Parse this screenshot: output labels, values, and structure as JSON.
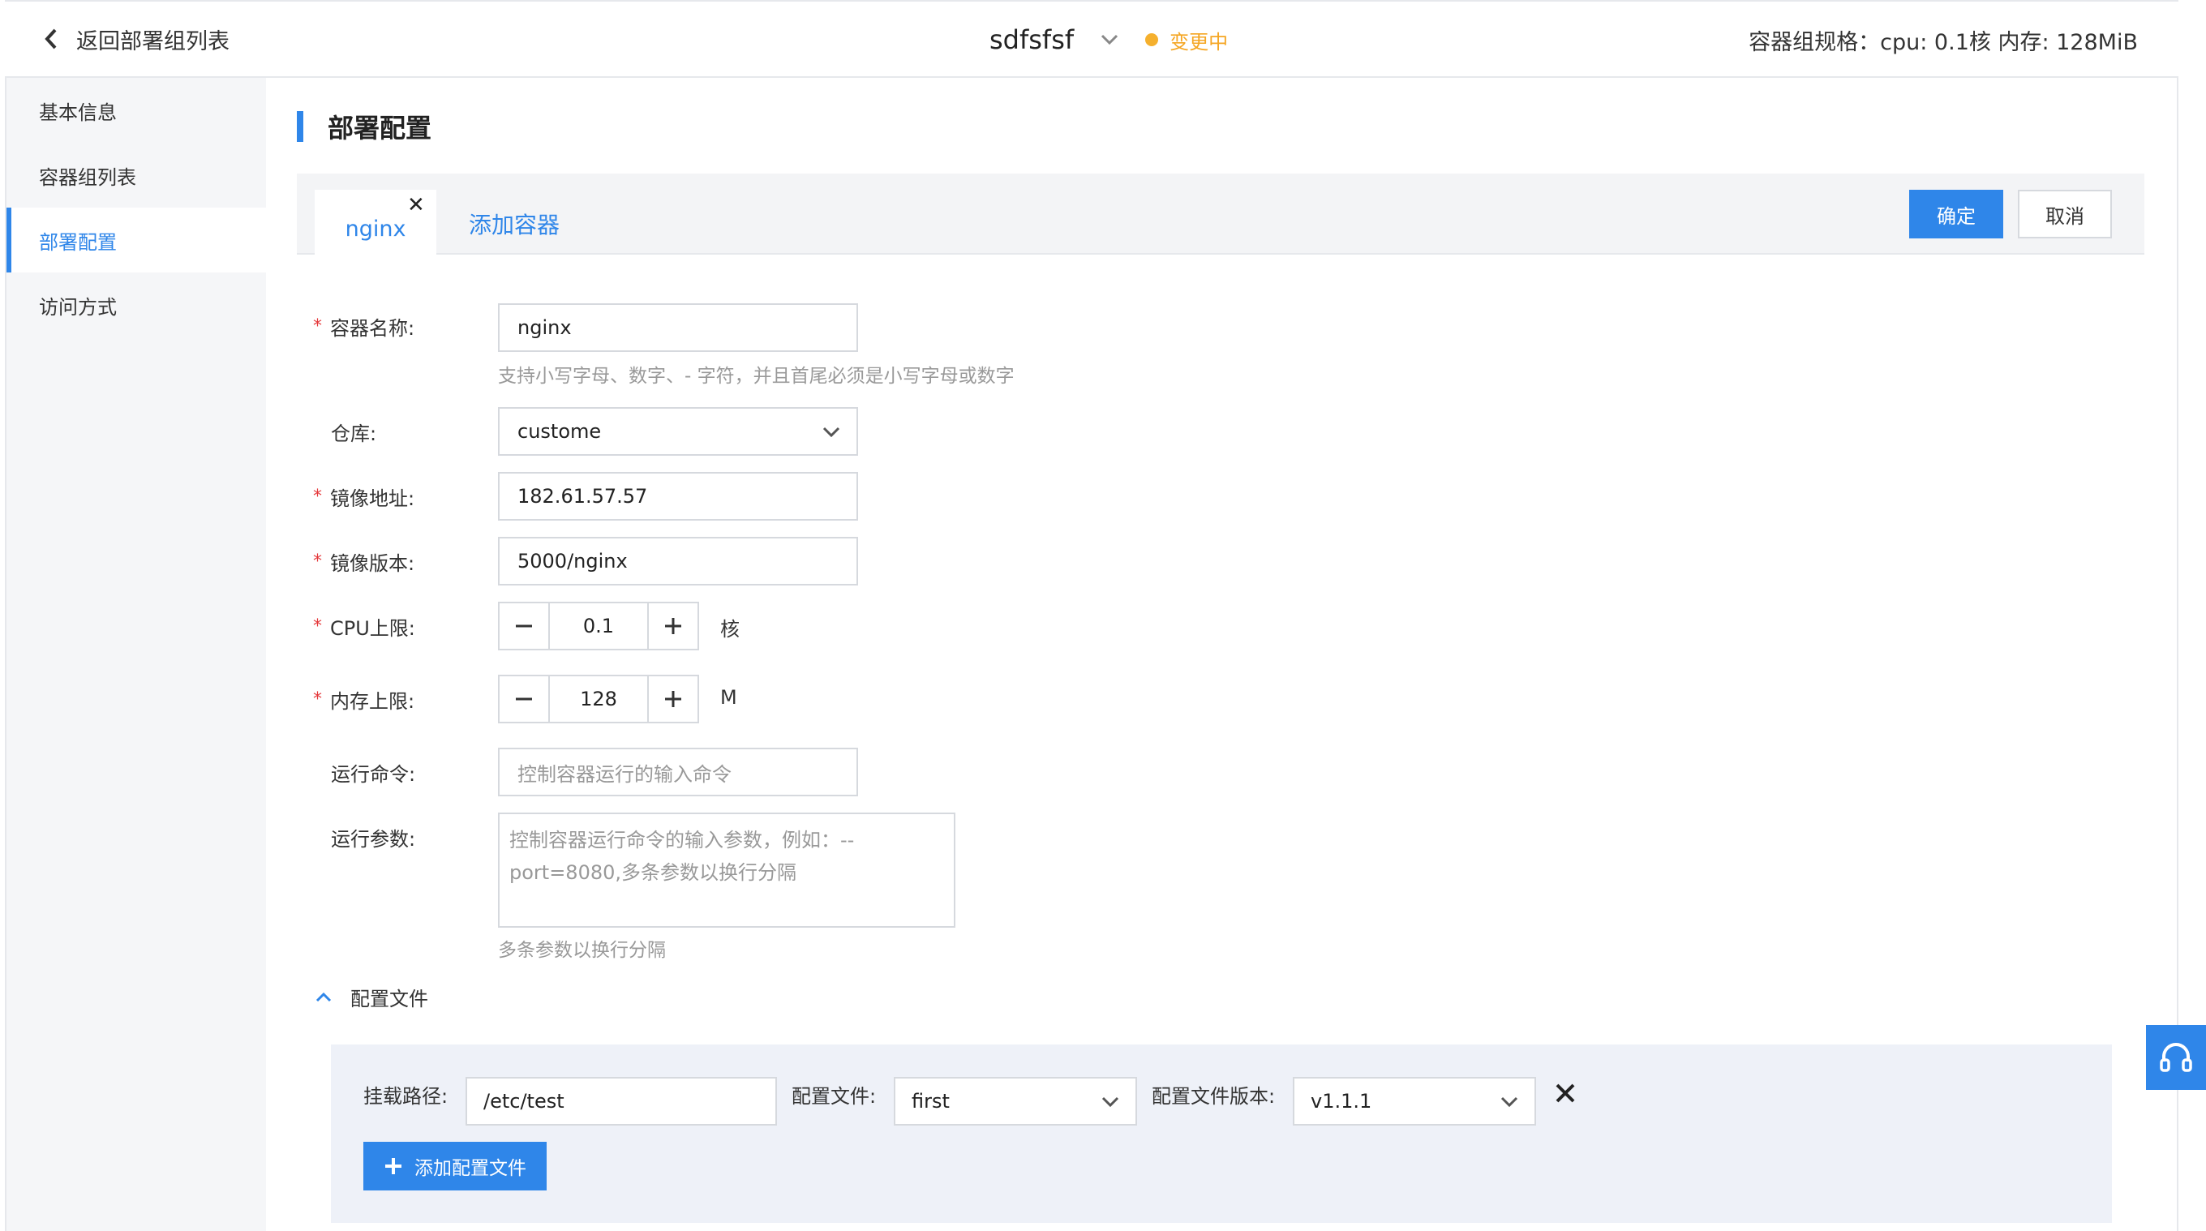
{
  "header": {
    "back_label": "返回部署组列表",
    "title": "sdfsfsf",
    "status": "变更中",
    "status_color": "#f5a623",
    "spec": "容器组规格：cpu: 0.1核 内存: 128MiB"
  },
  "sidebar": {
    "items": [
      {
        "label": "基本信息",
        "active": false
      },
      {
        "label": "容器组列表",
        "active": false
      },
      {
        "label": "部署配置",
        "active": true
      },
      {
        "label": "访问方式",
        "active": false
      }
    ]
  },
  "main": {
    "section_title": "部署配置",
    "tabs": {
      "active": "nginx",
      "add_label": "添加容器"
    },
    "actions": {
      "confirm": "确定",
      "cancel": "取消"
    },
    "form": {
      "container_name": {
        "label": "容器名称:",
        "value": "nginx",
        "hint": "支持小写字母、数字、- 字符，并且首尾必须是小写字母或数字"
      },
      "repository": {
        "label": "仓库:",
        "value": "custome"
      },
      "image_address": {
        "label": "镜像地址:",
        "value": "182.61.57.57"
      },
      "image_version": {
        "label": "镜像版本:",
        "value": "5000/nginx"
      },
      "cpu_limit": {
        "label": "CPU上限:",
        "value": "0.1",
        "unit": "核"
      },
      "memory_limit": {
        "label": "内存上限:",
        "value": "128",
        "unit": "M"
      },
      "run_command": {
        "label": "运行命令:",
        "placeholder": "控制容器运行的输入命令"
      },
      "run_args": {
        "label": "运行参数:",
        "placeholder_line1": "控制容器运行命令的输入参数，例如：--",
        "placeholder_line2": "port=8080,多条参数以换行分隔",
        "hint": "多条参数以换行分隔"
      }
    },
    "config_section": {
      "toggle_label": "配置文件",
      "mount_path_label": "挂载路径:",
      "mount_path_value": "/etc/test",
      "config_file_label": "配置文件:",
      "config_file_value": "first",
      "config_version_label": "配置文件版本:",
      "config_version_value": "v1.1.1",
      "add_button": "添加配置文件"
    }
  },
  "colors": {
    "accent": "#2f86e9",
    "required": "#e4393c",
    "panel": "#eef1f8"
  }
}
